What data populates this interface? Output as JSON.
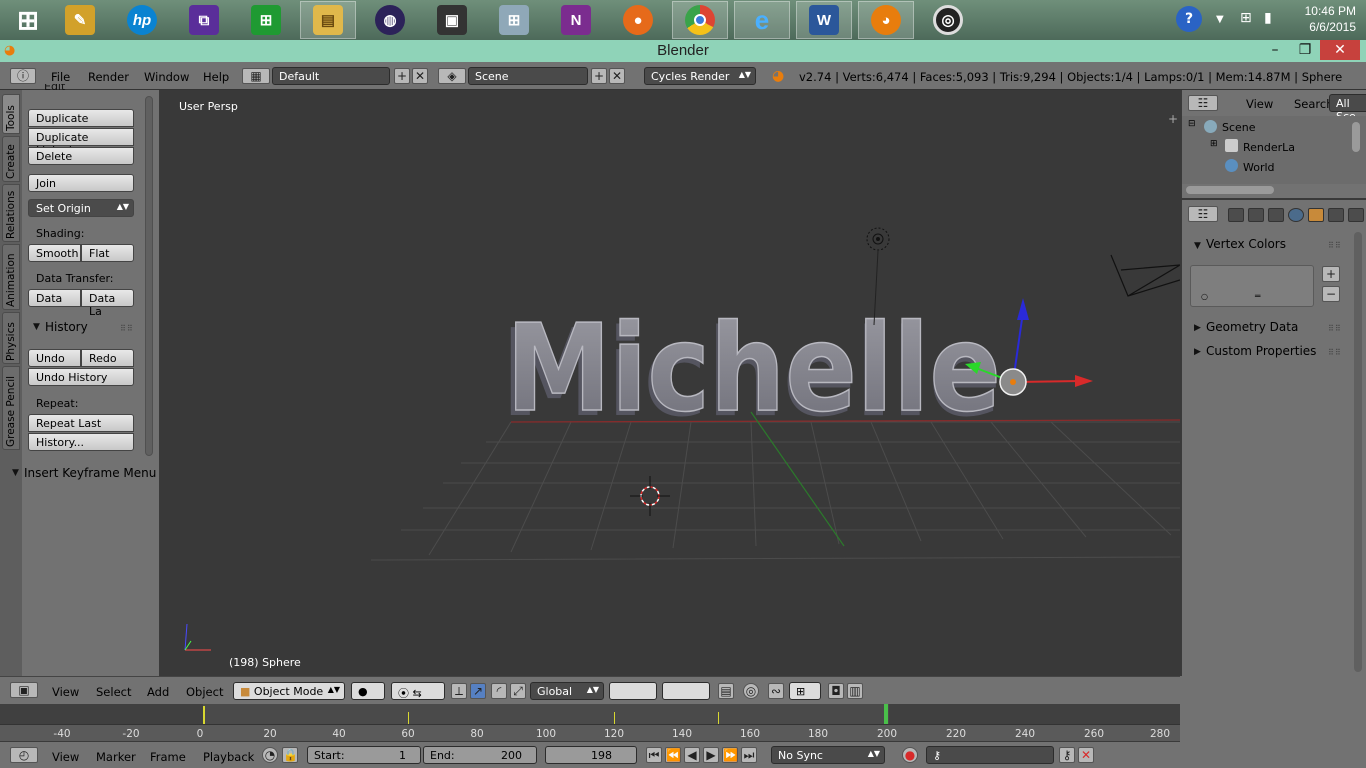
{
  "taskbar": {
    "apps": [
      {
        "name": "start",
        "glyph": "⊞",
        "color": "#2a63c5"
      },
      {
        "name": "tools",
        "glyph": "✎",
        "color": "#d2a12a"
      },
      {
        "name": "hp",
        "glyph": "hp",
        "color": "#0a83d1"
      },
      {
        "name": "visual-studio",
        "glyph": "⧉",
        "color": "#5a2e9a"
      },
      {
        "name": "store",
        "glyph": "⊞",
        "color": "#1f9a32"
      },
      {
        "name": "explorer",
        "glyph": "▤",
        "color": "#e0b84b"
      },
      {
        "name": "eclipse",
        "glyph": "◍",
        "color": "#2c2259"
      },
      {
        "name": "remote",
        "glyph": "▣",
        "color": "#333333"
      },
      {
        "name": "calculator",
        "glyph": "⊞",
        "color": "#8fa8b8"
      },
      {
        "name": "onenote",
        "glyph": "N",
        "color": "#7b2c8f"
      },
      {
        "name": "firefox",
        "glyph": "●",
        "color": "#e66a1a"
      },
      {
        "name": "chrome",
        "glyph": "◉",
        "color": "#dd4433"
      },
      {
        "name": "ie",
        "glyph": "e",
        "color": "#1e87d8"
      },
      {
        "name": "word",
        "glyph": "W",
        "color": "#2b579a"
      },
      {
        "name": "blender",
        "glyph": "◕",
        "color": "#e87d0d"
      },
      {
        "name": "obs",
        "glyph": "◎",
        "color": "#222222"
      }
    ],
    "time": "10:46 PM",
    "date": "6/6/2015"
  },
  "window": {
    "title": "Blender"
  },
  "infobar": {
    "menus": [
      "File",
      "Render",
      "Window",
      "Help"
    ],
    "layout": "Default",
    "scene": "Scene",
    "engine": "Cycles Render",
    "stats": "v2.74 | Verts:6,474 | Faces:5,093 | Tris:9,294 | Objects:1/4 | Lamps:0/1 | Mem:14.87M | Sphere"
  },
  "toolshelf": {
    "tabs": [
      "Tools",
      "Create",
      "Relations",
      "Animation",
      "Physics",
      "Grease Pencil"
    ],
    "edit_header": "Edit",
    "duplicate": "Duplicate",
    "duplicate_linked": "Duplicate Linked",
    "delete": "Delete",
    "join": "Join",
    "set_origin": "Set Origin",
    "shading_label": "Shading:",
    "smooth": "Smooth",
    "flat": "Flat",
    "data_transfer_label": "Data Transfer:",
    "data": "Data",
    "data_layout": "Data La",
    "history_header": "History",
    "undo": "Undo",
    "redo": "Redo",
    "undo_history": "Undo History",
    "repeat_label": "Repeat:",
    "repeat_last": "Repeat Last",
    "history_more": "History...",
    "insert_keyframe": "Insert Keyframe Menu"
  },
  "viewport": {
    "persp": "User Persp",
    "object": "(198) Sphere",
    "text": "Michelle"
  },
  "outliner": {
    "view": "View",
    "search": "Search",
    "all_scenes": "All Sce",
    "scene": "Scene",
    "render_layers": "RenderLa",
    "world": "World"
  },
  "properties": {
    "vertex_colors": "Vertex Colors",
    "geometry_data": "Geometry Data",
    "custom_properties": "Custom Properties"
  },
  "vpheader": {
    "menus": [
      "View",
      "Select",
      "Add",
      "Object"
    ],
    "mode": "Object Mode",
    "orientation": "Global"
  },
  "timeline": {
    "ticks": [
      "-40",
      "-20",
      "0",
      "20",
      "40",
      "60",
      "80",
      "100",
      "120",
      "140",
      "160",
      "180",
      "200",
      "220",
      "240",
      "260",
      "280"
    ],
    "menus": [
      "View",
      "Marker",
      "Frame",
      "Playback"
    ],
    "start_label": "Start:",
    "start": "1",
    "end_label": "End:",
    "end": "200",
    "current": "198",
    "sync": "No Sync"
  }
}
